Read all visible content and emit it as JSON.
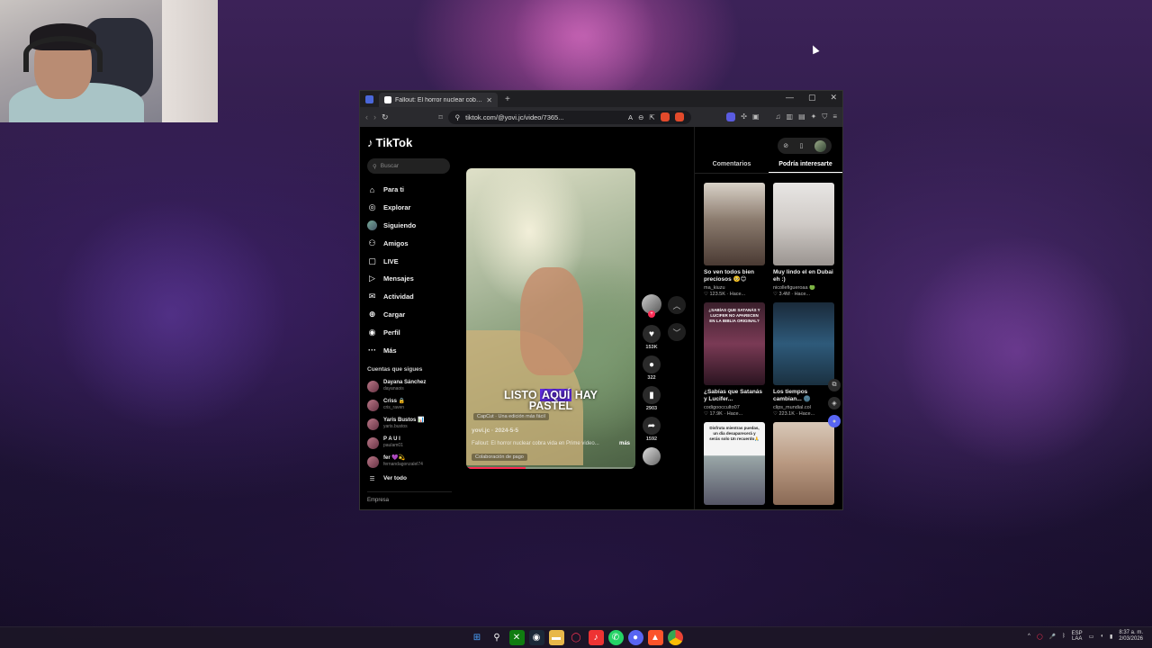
{
  "browser": {
    "tab_title": "Fallout: El horror nuclear cobra vida",
    "url": "tiktok.com/@yovi.jc/video/7365..."
  },
  "sidebar": {
    "logo": "TikTok",
    "search_placeholder": "Buscar",
    "items": [
      {
        "label": "Para ti",
        "icon": "home-icon"
      },
      {
        "label": "Explorar",
        "icon": "compass-icon"
      },
      {
        "label": "Siguiendo",
        "icon": "avatar-icon"
      },
      {
        "label": "Amigos",
        "icon": "friends-icon"
      },
      {
        "label": "LIVE",
        "icon": "live-icon"
      },
      {
        "label": "Mensajes",
        "icon": "send-icon"
      },
      {
        "label": "Actividad",
        "icon": "inbox-icon"
      },
      {
        "label": "Cargar",
        "icon": "plus-icon"
      },
      {
        "label": "Perfil",
        "icon": "user-icon"
      },
      {
        "label": "Más",
        "icon": "more-icon"
      }
    ],
    "following_title": "Cuentas que sigues",
    "following": [
      {
        "name": "Dayana Sánchez",
        "handle": "dayanaois"
      },
      {
        "name": "Criss 🔒",
        "handle": "cris_raven"
      },
      {
        "name": "Yaris Bustos 📊",
        "handle": "yaris.bustos"
      },
      {
        "name": "P A U I",
        "handle": "paulam01"
      },
      {
        "name": "fer 💜💫",
        "handle": "fernandagonzalel74"
      }
    ],
    "see_all": "Ver todo",
    "footer": "Empresa"
  },
  "video": {
    "caption_pre": "LISTO ",
    "caption_highlight": "AQUÍ",
    "caption_post": " HAY",
    "caption_line2": "PASTEL",
    "capcut": "CapCut · Una edición más fácil",
    "author": "yovi.jc · 2024-5-5",
    "description": "Fallout: El horror nuclear cobra vida en Prime video...",
    "more": "más",
    "collab": "Colaboración de pago",
    "progress": 0.35
  },
  "actions": {
    "likes": "153K",
    "comments": "322",
    "saves": "2903",
    "shares": "1592"
  },
  "right_panel": {
    "tabs": [
      "Comentarios",
      "Podría interesarte"
    ],
    "active_tab": 1,
    "cards": [
      {
        "title": "So ven todos bien preciosos 🥺😊",
        "user": "ma_kiuzu",
        "stats": "♡ 123.5K · Hace..."
      },
      {
        "title": "Muy lindo el en Dubai eh :)",
        "user": "nicollefigueroaa 🟢",
        "stats": "♡ 3.4M · Hace..."
      },
      {
        "title": "¿Sabías que Satanás y Lucifer...",
        "user": "codigoocculto07",
        "stats": "♡ 17.9K · Hace..."
      },
      {
        "title": "Los tiempos cambian... 🌚",
        "user": "clips_mundial.col",
        "stats": "♡ 223.1K · Hace..."
      },
      {
        "title": "",
        "user": "",
        "stats": ""
      },
      {
        "title": "",
        "user": "",
        "stats": ""
      }
    ],
    "card2_overlay": "¿SABÍAS QUE SATANÁS Y LUCIFER NO APARECEN EN LA BIBLIA ORIGINAL?",
    "card5_overlay": "Disfruta mientras puedas, un día desaparecerá y serás solo Un recuerdo🙏"
  },
  "taskbar": {
    "lang1": "ESP",
    "lang2": "LAA",
    "time": "8:37 a. m.",
    "date": "2/03/2026"
  },
  "colors": {
    "accent": "#fe2c55",
    "highlight": "#5f2be0"
  }
}
